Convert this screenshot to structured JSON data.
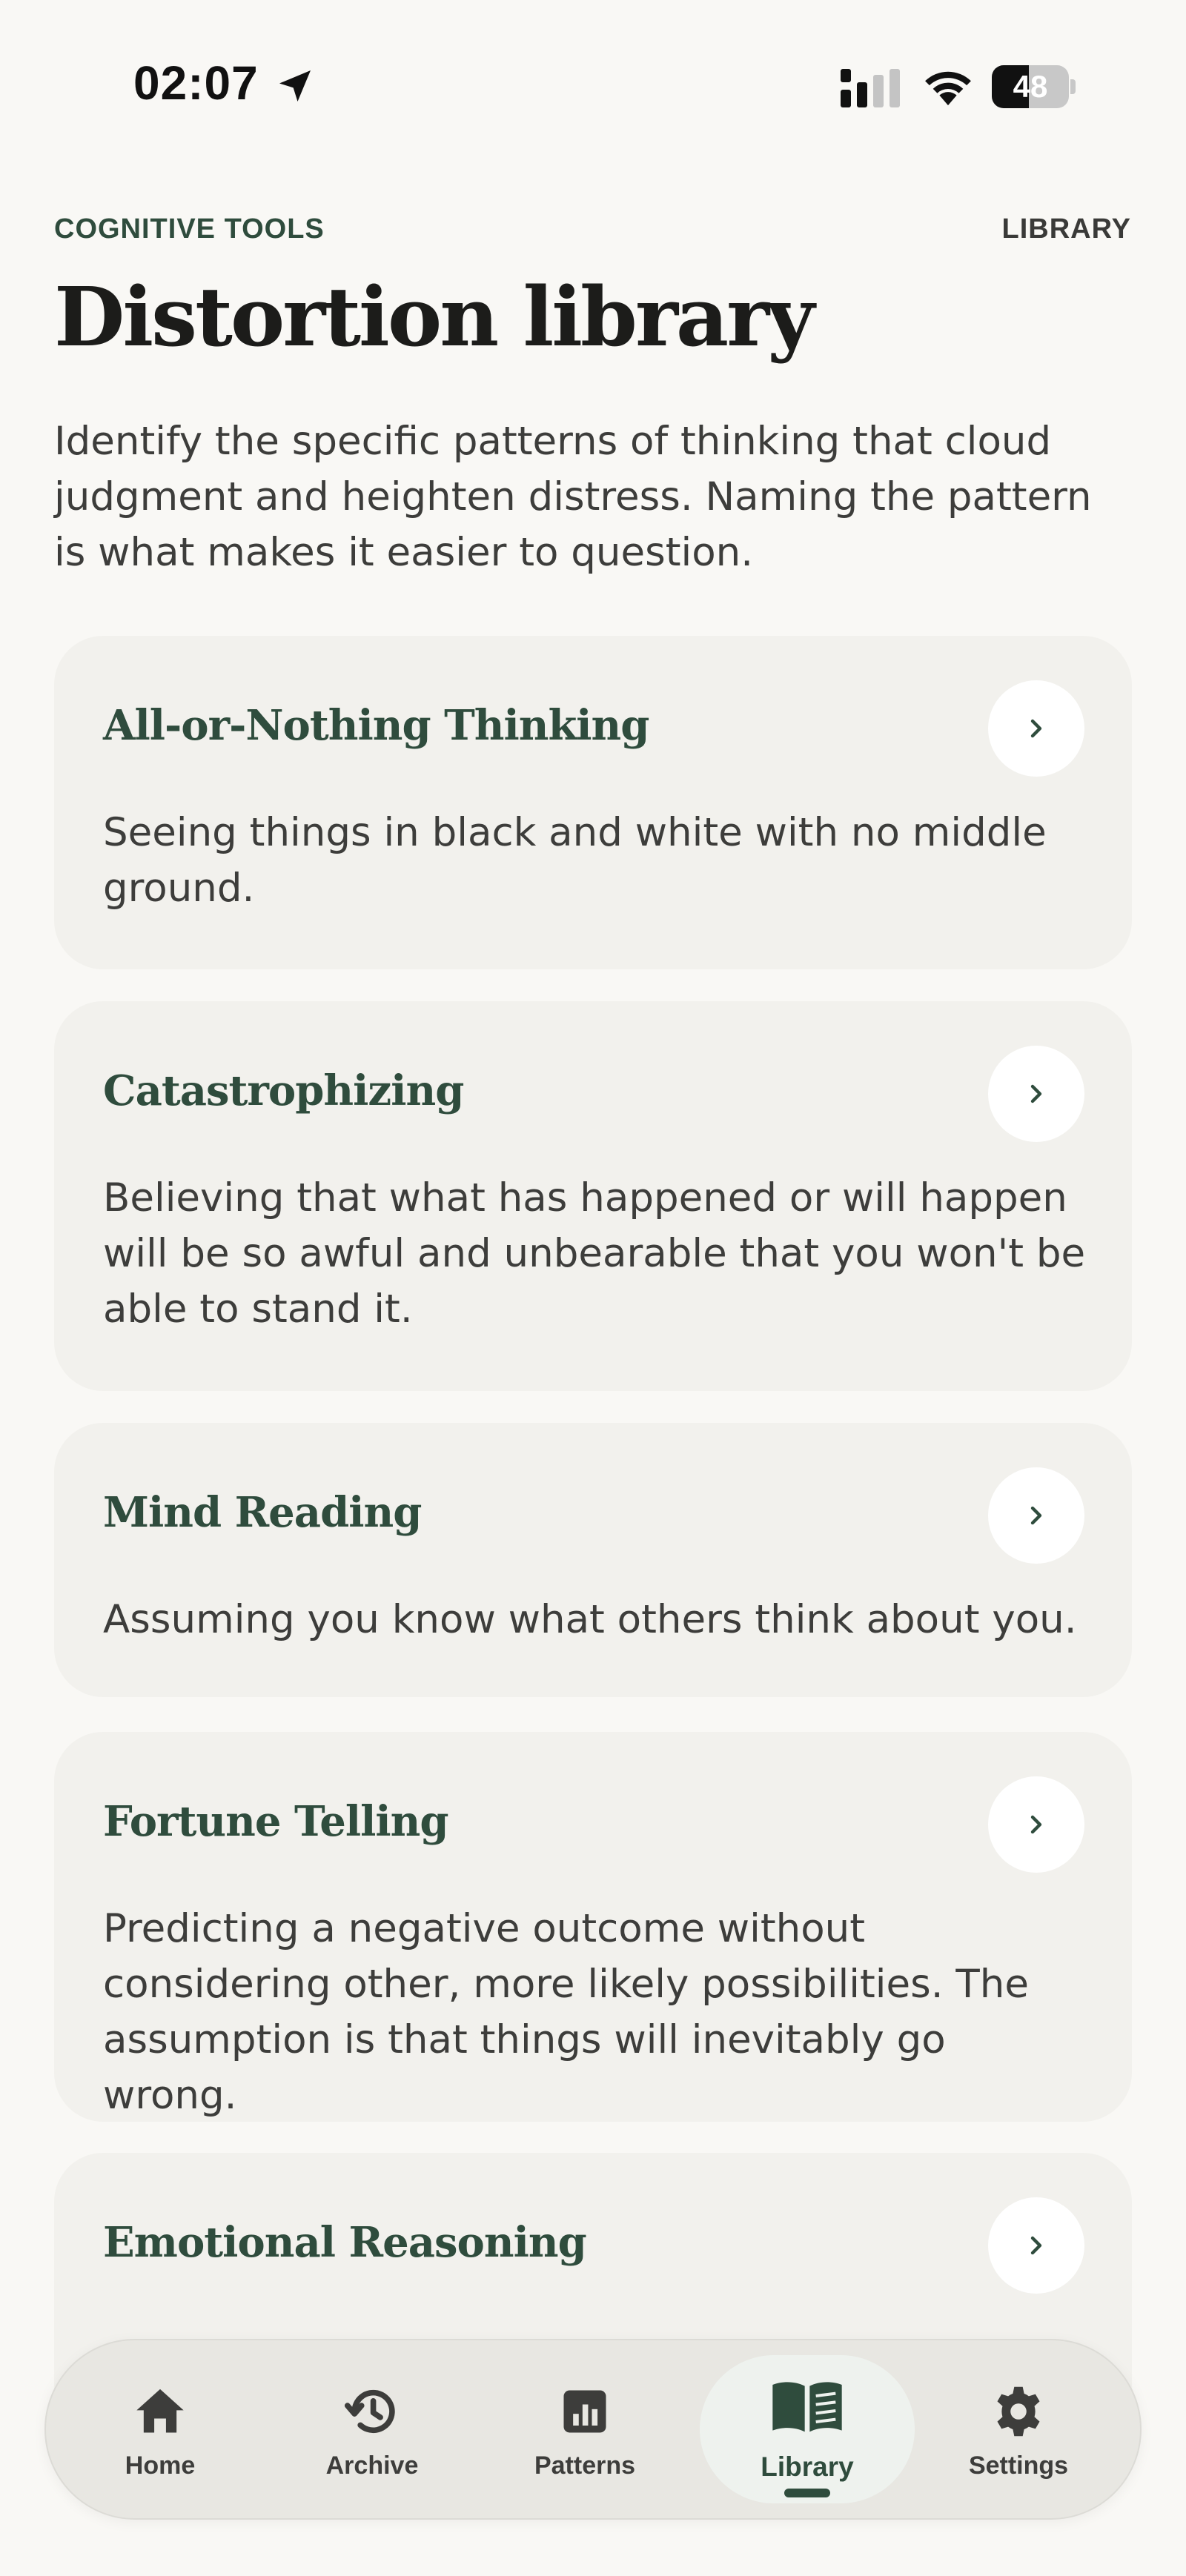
{
  "status_bar": {
    "time": "02:07",
    "battery_level": "48",
    "icons": [
      "location-arrow-icon",
      "cellular-signal-icon",
      "wifi-icon",
      "battery-icon"
    ]
  },
  "header": {
    "eyebrow": "COGNITIVE TOOLS",
    "section": "LIBRARY",
    "title": "Distortion library",
    "intro": "Identify the specific patterns of thinking that cloud judgment and heighten distress. Naming the pattern is what makes it easier to question."
  },
  "distortions": [
    {
      "title": "All-or-Nothing Thinking",
      "description": "Seeing things in black and white with no middle ground."
    },
    {
      "title": "Catastrophizing",
      "description": "Believing that what has happened or will happen will be so awful and unbearable that you won't be able to stand it."
    },
    {
      "title": "Mind Reading",
      "description": "Assuming you know what others think about you."
    },
    {
      "title": "Fortune Telling",
      "description": "Predicting a negative outcome without considering other, more likely possibilities. The assumption is that things will inevitably go wrong."
    },
    {
      "title": "Emotional Reasoning",
      "description": ""
    }
  ],
  "tabs": [
    {
      "label": "Home",
      "icon": "home-icon"
    },
    {
      "label": "Archive",
      "icon": "history-icon"
    },
    {
      "label": "Patterns",
      "icon": "bar-chart-icon"
    },
    {
      "label": "Library",
      "icon": "open-book-icon",
      "active": true
    },
    {
      "label": "Settings",
      "icon": "gear-icon"
    }
  ],
  "colors": {
    "background": "#f9f8f5",
    "card": "#f2f1ed",
    "accent_green": "#2f4c3d",
    "body_text": "#3d3d3b",
    "tab_bar": "#e8e7e2",
    "active_tab": "#eef2ee"
  }
}
